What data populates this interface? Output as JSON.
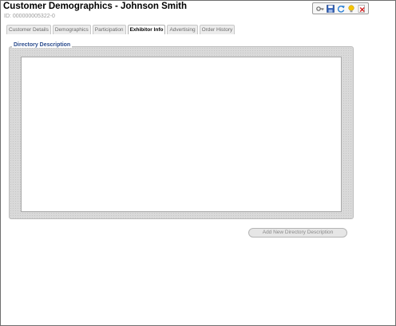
{
  "header": {
    "title": "Customer Demographics - Johnson Smith",
    "record_id": "ID: 000000005322-0"
  },
  "toolbar": {
    "icons": [
      "key-icon",
      "save-icon",
      "refresh-icon",
      "lightbulb-icon",
      "close-document-icon"
    ]
  },
  "tabs": [
    {
      "label": "Customer Details",
      "active": false
    },
    {
      "label": "Demographics",
      "active": false
    },
    {
      "label": "Participation",
      "active": false
    },
    {
      "label": "Exhibitor Info",
      "active": true
    },
    {
      "label": "Advertising",
      "active": false
    },
    {
      "label": "Order History",
      "active": false
    }
  ],
  "directory": {
    "legend": "Directory Description",
    "value": "",
    "add_button_label": "Add New Directory Description"
  },
  "colors": {
    "legend_text": "#2a4b8d",
    "panel_bg": "#d9d9d9",
    "frame_border": "#6e6e6e"
  }
}
